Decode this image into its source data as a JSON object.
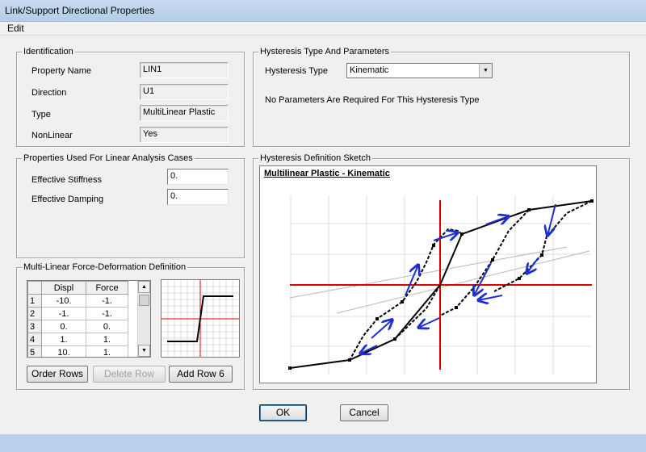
{
  "window": {
    "title": "Link/Support Directional Properties"
  },
  "menu": {
    "edit": "Edit"
  },
  "identification": {
    "title": "Identification",
    "property_name_label": "Property Name",
    "property_name_value": "LIN1",
    "direction_label": "Direction",
    "direction_value": "U1",
    "type_label": "Type",
    "type_value": "MultiLinear Plastic",
    "nonlinear_label": "NonLinear",
    "nonlinear_value": "Yes"
  },
  "linear": {
    "title": "Properties Used For Linear Analysis Cases",
    "stiffness_label": "Effective Stiffness",
    "stiffness_value": "0.",
    "damping_label": "Effective Damping",
    "damping_value": "0."
  },
  "multilinear": {
    "title": "Multi-Linear Force-Deformation Definition",
    "columns": [
      "Displ",
      "Force"
    ],
    "rows": [
      {
        "n": "1",
        "displ": "-10.",
        "force": "-1."
      },
      {
        "n": "2",
        "displ": "-1.",
        "force": "-1."
      },
      {
        "n": "3",
        "displ": "0.",
        "force": "0."
      },
      {
        "n": "4",
        "displ": "1.",
        "force": "1."
      },
      {
        "n": "5",
        "displ": "10.",
        "force": "1."
      }
    ],
    "order_rows": "Order Rows",
    "delete_row": "Delete Row",
    "add_row": "Add Row 6"
  },
  "hysteresis": {
    "title": "Hysteresis Type And Parameters",
    "type_label": "Hysteresis Type",
    "type_value": "Kinematic",
    "note": "No Parameters Are Required For This Hysteresis Type"
  },
  "sketch": {
    "group_title": "Hysteresis Definition Sketch",
    "title": "Multilinear Plastic - Kinematic",
    "colors": {
      "axes": "#e00000",
      "curve": "#000000",
      "arrows": "#1f2fd0",
      "grid": "#dcdcdc",
      "guides": "#b8b8b8"
    }
  },
  "buttons": {
    "ok": "OK",
    "cancel": "Cancel"
  }
}
